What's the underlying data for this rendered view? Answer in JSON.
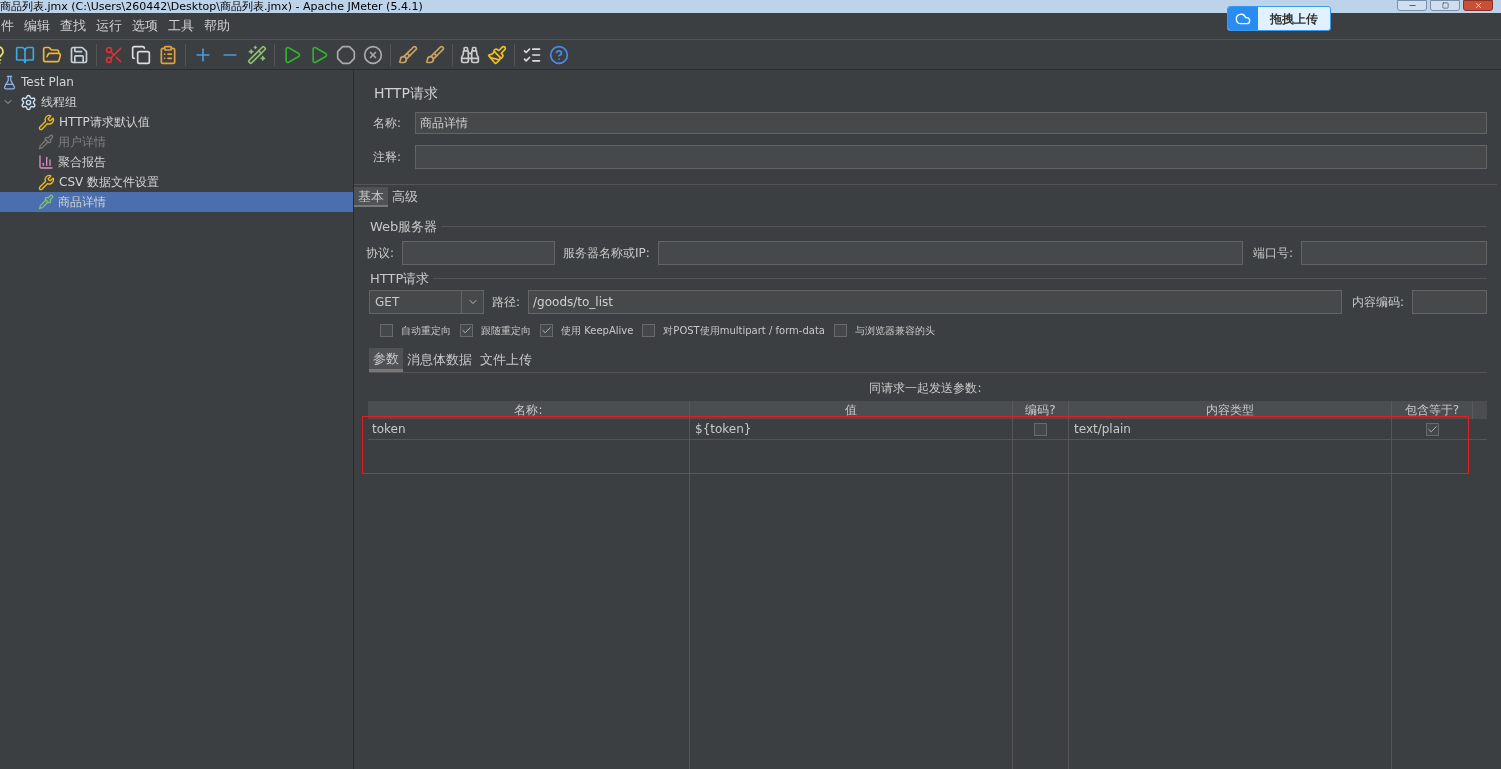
{
  "window": {
    "title": "商品列表.jmx (C:\\Users\\260442\\Desktop\\商品列表.jmx) - Apache JMeter (5.4.1)"
  },
  "upload_badge": {
    "label": "拖拽上传"
  },
  "menu": [
    "件",
    "编辑",
    "查找",
    "运行",
    "选项",
    "工具",
    "帮助"
  ],
  "tree": [
    {
      "label": "Test Plan",
      "kind": "plan",
      "selected": false,
      "disabled": false,
      "children": [
        {
          "label": "线程组",
          "kind": "threads",
          "selected": false,
          "disabled": false,
          "expanded": true,
          "children": [
            {
              "label": "HTTP请求默认值",
              "kind": "config",
              "selected": false,
              "disabled": false
            },
            {
              "label": "用户详情",
              "kind": "sampler",
              "selected": false,
              "disabled": true
            },
            {
              "label": "聚合报告",
              "kind": "report",
              "selected": false,
              "disabled": false
            },
            {
              "label": "CSV 数据文件设置",
              "kind": "config",
              "selected": false,
              "disabled": false
            },
            {
              "label": "商品详情",
              "kind": "sampler",
              "selected": true,
              "disabled": false
            }
          ]
        }
      ]
    }
  ],
  "panel": {
    "title": "HTTP请求",
    "name_label": "名称:",
    "name_value": "商品详情",
    "comment_label": "注释:",
    "tabs": [
      {
        "label": "基本",
        "selected": true
      },
      {
        "label": "高级",
        "selected": false
      }
    ],
    "web_server": {
      "legend": "Web服务器",
      "protocol_label": "协议:",
      "server_label": "服务器名称或IP:",
      "port_label": "端口号:"
    },
    "http_request": {
      "legend": "HTTP请求",
      "method": "GET",
      "path_label": "路径:",
      "path": "/goods/to_list",
      "encoding_label": "内容编码:"
    },
    "options": [
      {
        "label": "自动重定向",
        "checked": false
      },
      {
        "label": "跟随重定向",
        "checked": true
      },
      {
        "label": "使用 KeepAlive",
        "checked": true
      },
      {
        "label": "对POST使用multipart / form-data",
        "checked": false
      },
      {
        "label": "与浏览器兼容的头",
        "checked": false
      }
    ],
    "sub_tabs": [
      {
        "label": "参数",
        "selected": true
      },
      {
        "label": "消息体数据",
        "selected": false
      },
      {
        "label": "文件上传",
        "selected": false
      }
    ],
    "params": {
      "caption": "同请求一起发送参数:",
      "columns": [
        "名称:",
        "值",
        "编码?",
        "内容类型",
        "包含等于?"
      ],
      "rows": [
        {
          "name": "token",
          "value": "${token}",
          "encode": false,
          "content_type": "text/plain",
          "include_equals": true
        }
      ]
    }
  }
}
